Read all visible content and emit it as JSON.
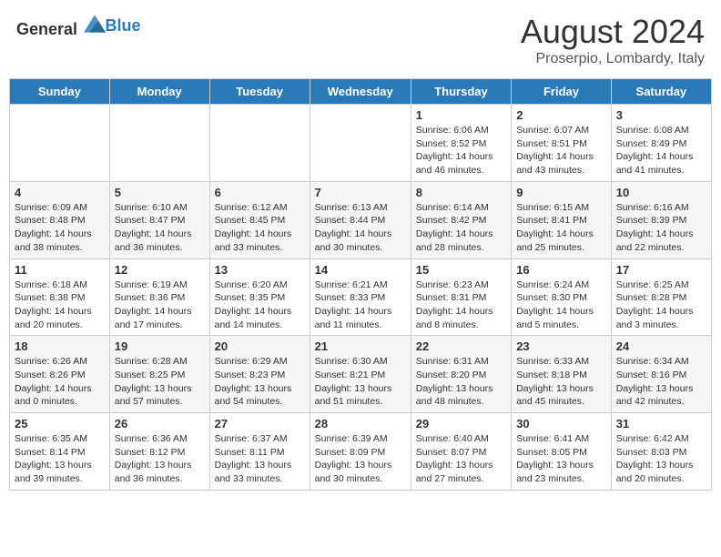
{
  "header": {
    "logo_general": "General",
    "logo_blue": "Blue",
    "month_title": "August 2024",
    "location": "Proserpio, Lombardy, Italy"
  },
  "weekdays": [
    "Sunday",
    "Monday",
    "Tuesday",
    "Wednesday",
    "Thursday",
    "Friday",
    "Saturday"
  ],
  "weeks": [
    [
      {
        "day": "",
        "info": ""
      },
      {
        "day": "",
        "info": ""
      },
      {
        "day": "",
        "info": ""
      },
      {
        "day": "",
        "info": ""
      },
      {
        "day": "1",
        "info": "Sunrise: 6:06 AM\nSunset: 8:52 PM\nDaylight: 14 hours and 46 minutes."
      },
      {
        "day": "2",
        "info": "Sunrise: 6:07 AM\nSunset: 8:51 PM\nDaylight: 14 hours and 43 minutes."
      },
      {
        "day": "3",
        "info": "Sunrise: 6:08 AM\nSunset: 8:49 PM\nDaylight: 14 hours and 41 minutes."
      }
    ],
    [
      {
        "day": "4",
        "info": "Sunrise: 6:09 AM\nSunset: 8:48 PM\nDaylight: 14 hours and 38 minutes."
      },
      {
        "day": "5",
        "info": "Sunrise: 6:10 AM\nSunset: 8:47 PM\nDaylight: 14 hours and 36 minutes."
      },
      {
        "day": "6",
        "info": "Sunrise: 6:12 AM\nSunset: 8:45 PM\nDaylight: 14 hours and 33 minutes."
      },
      {
        "day": "7",
        "info": "Sunrise: 6:13 AM\nSunset: 8:44 PM\nDaylight: 14 hours and 30 minutes."
      },
      {
        "day": "8",
        "info": "Sunrise: 6:14 AM\nSunset: 8:42 PM\nDaylight: 14 hours and 28 minutes."
      },
      {
        "day": "9",
        "info": "Sunrise: 6:15 AM\nSunset: 8:41 PM\nDaylight: 14 hours and 25 minutes."
      },
      {
        "day": "10",
        "info": "Sunrise: 6:16 AM\nSunset: 8:39 PM\nDaylight: 14 hours and 22 minutes."
      }
    ],
    [
      {
        "day": "11",
        "info": "Sunrise: 6:18 AM\nSunset: 8:38 PM\nDaylight: 14 hours and 20 minutes."
      },
      {
        "day": "12",
        "info": "Sunrise: 6:19 AM\nSunset: 8:36 PM\nDaylight: 14 hours and 17 minutes."
      },
      {
        "day": "13",
        "info": "Sunrise: 6:20 AM\nSunset: 8:35 PM\nDaylight: 14 hours and 14 minutes."
      },
      {
        "day": "14",
        "info": "Sunrise: 6:21 AM\nSunset: 8:33 PM\nDaylight: 14 hours and 11 minutes."
      },
      {
        "day": "15",
        "info": "Sunrise: 6:23 AM\nSunset: 8:31 PM\nDaylight: 14 hours and 8 minutes."
      },
      {
        "day": "16",
        "info": "Sunrise: 6:24 AM\nSunset: 8:30 PM\nDaylight: 14 hours and 5 minutes."
      },
      {
        "day": "17",
        "info": "Sunrise: 6:25 AM\nSunset: 8:28 PM\nDaylight: 14 hours and 3 minutes."
      }
    ],
    [
      {
        "day": "18",
        "info": "Sunrise: 6:26 AM\nSunset: 8:26 PM\nDaylight: 14 hours and 0 minutes."
      },
      {
        "day": "19",
        "info": "Sunrise: 6:28 AM\nSunset: 8:25 PM\nDaylight: 13 hours and 57 minutes."
      },
      {
        "day": "20",
        "info": "Sunrise: 6:29 AM\nSunset: 8:23 PM\nDaylight: 13 hours and 54 minutes."
      },
      {
        "day": "21",
        "info": "Sunrise: 6:30 AM\nSunset: 8:21 PM\nDaylight: 13 hours and 51 minutes."
      },
      {
        "day": "22",
        "info": "Sunrise: 6:31 AM\nSunset: 8:20 PM\nDaylight: 13 hours and 48 minutes."
      },
      {
        "day": "23",
        "info": "Sunrise: 6:33 AM\nSunset: 8:18 PM\nDaylight: 13 hours and 45 minutes."
      },
      {
        "day": "24",
        "info": "Sunrise: 6:34 AM\nSunset: 8:16 PM\nDaylight: 13 hours and 42 minutes."
      }
    ],
    [
      {
        "day": "25",
        "info": "Sunrise: 6:35 AM\nSunset: 8:14 PM\nDaylight: 13 hours and 39 minutes."
      },
      {
        "day": "26",
        "info": "Sunrise: 6:36 AM\nSunset: 8:12 PM\nDaylight: 13 hours and 36 minutes."
      },
      {
        "day": "27",
        "info": "Sunrise: 6:37 AM\nSunset: 8:11 PM\nDaylight: 13 hours and 33 minutes."
      },
      {
        "day": "28",
        "info": "Sunrise: 6:39 AM\nSunset: 8:09 PM\nDaylight: 13 hours and 30 minutes."
      },
      {
        "day": "29",
        "info": "Sunrise: 6:40 AM\nSunset: 8:07 PM\nDaylight: 13 hours and 27 minutes."
      },
      {
        "day": "30",
        "info": "Sunrise: 6:41 AM\nSunset: 8:05 PM\nDaylight: 13 hours and 23 minutes."
      },
      {
        "day": "31",
        "info": "Sunrise: 6:42 AM\nSunset: 8:03 PM\nDaylight: 13 hours and 20 minutes."
      }
    ]
  ]
}
